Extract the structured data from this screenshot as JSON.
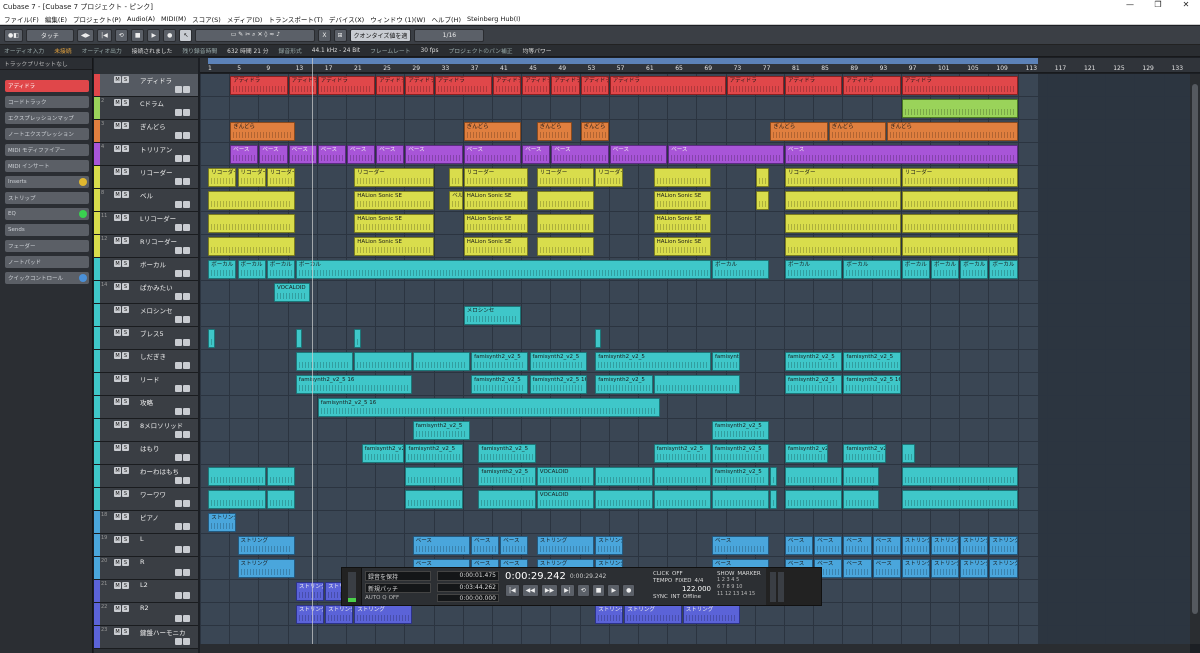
{
  "window": {
    "title": "Cubase 7 - [Cubase 7 プロジェクト - ピンク]",
    "min": "—",
    "max": "❐",
    "close": "✕"
  },
  "menu": [
    "ファイル(F)",
    "編集(E)",
    "プロジェクト(P)",
    "Audio(A)",
    "MIDI(M)",
    "スコア(S)",
    "メディア(D)",
    "トランスポート(T)",
    "デバイス(X)",
    "ウィンドウ (1)(W)",
    "ヘルプ(H)",
    "Steinberg Hub(I)"
  ],
  "toolbar": {
    "mode": "タッチ",
    "quantize": "クオンタイズ値を適",
    "grid": "1/16"
  },
  "infoline": {
    "out": "オーディオ入力",
    "out_val": "未接続",
    "in": "オーディオ出力",
    "in_val": "接続されました",
    "rec": "残り録音時間",
    "rec_val": "632 時間 21 分",
    "fmt": "録音形式",
    "fmt_val": "44.1 kHz - 24 Bit",
    "fr": "フレームレート",
    "fr_val": "30 fps",
    "pan": "プロジェクトのパン補正",
    "pan_val": "均等パワー"
  },
  "inspector": {
    "header": "トラックプリセットなし",
    "items": [
      "アディドラ",
      "コードトラック",
      "エクスプレッションマップ",
      "ノートエクスプレッション",
      "MIDI モディファイアー",
      "MIDI インサート",
      "Inserts",
      "ストリップ",
      "EQ",
      "Sends",
      "フェーダー",
      "ノートパッド",
      "クイックコントロール"
    ]
  },
  "tracks": [
    {
      "num": "",
      "name": "アディドラ"
    },
    {
      "num": "2",
      "name": "Cドラム"
    },
    {
      "num": "3",
      "name": "ぎんどら"
    },
    {
      "num": "4",
      "name": "トリリアン"
    },
    {
      "num": "",
      "name": "リコーダー"
    },
    {
      "num": "8",
      "name": "ベル"
    },
    {
      "num": "11",
      "name": "Lリコーダー"
    },
    {
      "num": "12",
      "name": "Rリコーダー"
    },
    {
      "num": "",
      "name": "ボーカル"
    },
    {
      "num": "14",
      "name": "ぱかみたい"
    },
    {
      "num": "",
      "name": "メロシンセ"
    },
    {
      "num": "",
      "name": "ブレス5"
    },
    {
      "num": "",
      "name": "しだぎき"
    },
    {
      "num": "",
      "name": "リード"
    },
    {
      "num": "",
      "name": "攻略"
    },
    {
      "num": "",
      "name": "8メロソリッド"
    },
    {
      "num": "",
      "name": "はもり"
    },
    {
      "num": "",
      "name": "わーわはもち"
    },
    {
      "num": "",
      "name": "ワーワワ"
    },
    {
      "num": "18",
      "name": "ピアノ"
    },
    {
      "num": "19",
      "name": "L"
    },
    {
      "num": "20",
      "name": "R"
    },
    {
      "num": "21",
      "name": "L2"
    },
    {
      "num": "22",
      "name": "R2"
    },
    {
      "num": "23",
      "name": "鍵盤ハーモニカ"
    }
  ],
  "ruler": [
    "1",
    "5",
    "9",
    "13",
    "17",
    "21",
    "25",
    "29",
    "33",
    "37",
    "41",
    "45",
    "49",
    "53",
    "57",
    "61",
    "65",
    "69",
    "73",
    "77",
    "81",
    "85",
    "89",
    "93",
    "97",
    "101",
    "105",
    "109",
    "113",
    "117",
    "121",
    "125",
    "129",
    "133"
  ],
  "labels": {
    "adi": "アディドラ",
    "gin": "ぎんどら",
    "base": "ベース",
    "rec": "リコーダー",
    "halion": "HALion Sonic SE",
    "vocal": "ボーカル",
    "vocaloid": "VOCALOID",
    "melo": "メロシンセ",
    "fami": "famisynth2_v2_5",
    "fami16": "famisynth2_v2_5 16",
    "string": "ストリング",
    "bell": "ベル"
  },
  "transport": {
    "label1": "録音を保持",
    "label2": "新規パッチ",
    "auto": "AUTO Q",
    "off": "OFF",
    "t1": "0:00:01.475",
    "t2": "0:03:44.262",
    "t3": "0:00:00.000",
    "main": "0:00:29.242",
    "sub": "0:00:29.242",
    "click": "CLICK",
    "click_val": "OFF",
    "tempo": "TEMPO",
    "tempo_fixed": "FIXED",
    "sig": "4/4",
    "bpm": "122.000",
    "sync": "SYNC",
    "int": "INT",
    "offline": "Offline",
    "show": "SHOW",
    "marker": "MARKER"
  },
  "colors": {
    "red": "#e0474a",
    "green": "#9ad35a",
    "orange": "#e07f3f",
    "purple": "#a855d8",
    "yellow": "#d9dd4c",
    "teal": "#3fc7c9",
    "blue": "#4aa6dc",
    "indigo": "#5b63d8"
  }
}
